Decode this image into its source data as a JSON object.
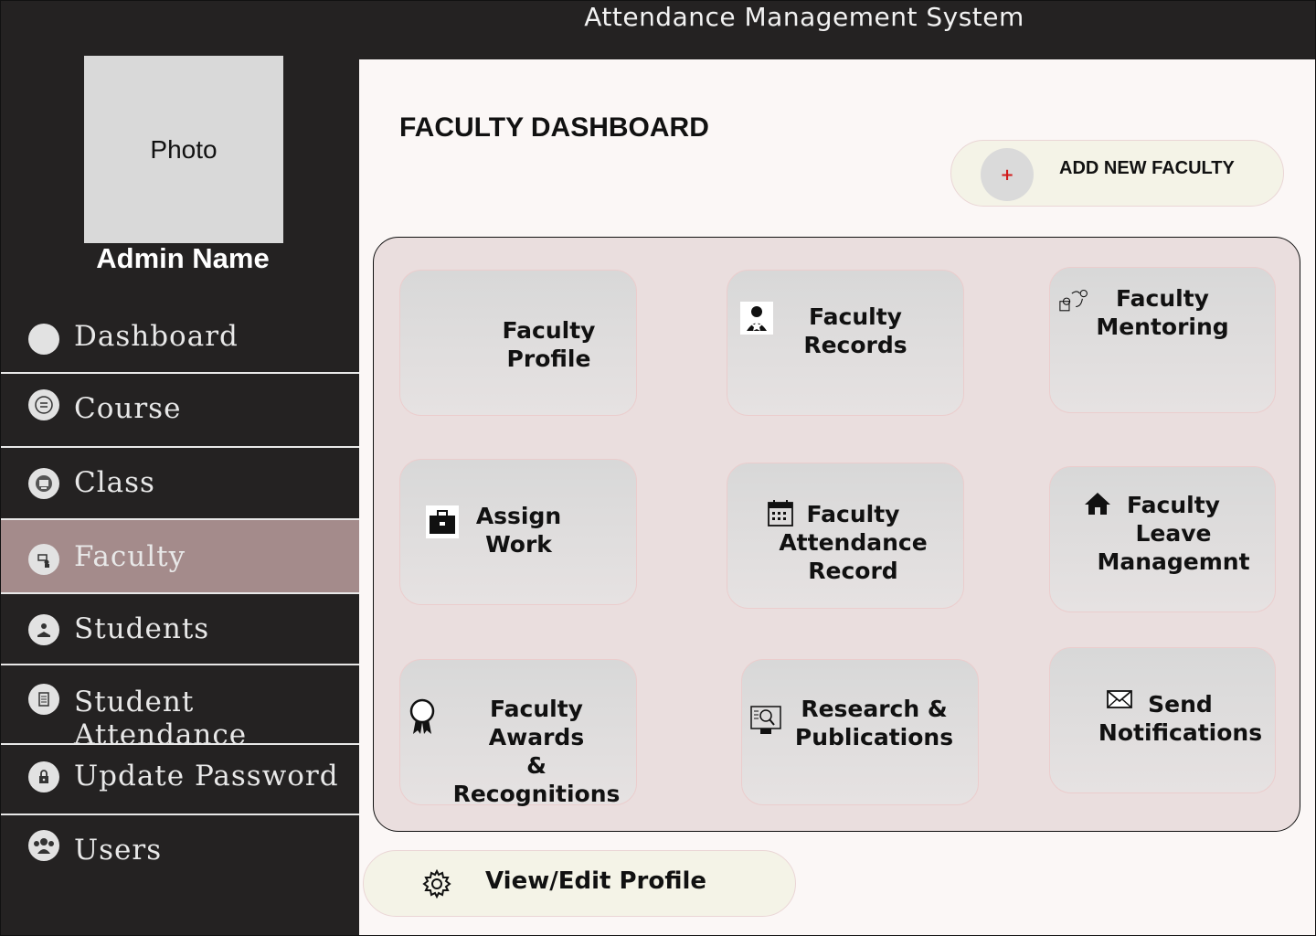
{
  "app": {
    "title": "Attendance Management System"
  },
  "sidebar": {
    "photo_label": "Photo",
    "admin_name": "Admin Name",
    "items": [
      {
        "label": "Dashboard",
        "icon": "circle-icon"
      },
      {
        "label": "Course",
        "icon": "list-icon"
      },
      {
        "label": "Class",
        "icon": "classroom-icon"
      },
      {
        "label": "Faculty",
        "icon": "teacher-icon",
        "active": true
      },
      {
        "label": "Students",
        "icon": "student-icon"
      },
      {
        "label": "Student Attendance",
        "icon": "clipboard-icon"
      },
      {
        "label": "Update Password",
        "icon": "lock-icon"
      },
      {
        "label": "Users",
        "icon": "users-icon"
      }
    ]
  },
  "main": {
    "page_title": "FACULTY DASHBOARD",
    "add_button": {
      "label": "ADD NEW FACULTY",
      "icon": "plus-icon",
      "plus": "+"
    },
    "cards": [
      {
        "label": "Faculty Profile",
        "icon": ""
      },
      {
        "label": "Faculty\nRecords",
        "icon": "faculty-icon"
      },
      {
        "label": "Faculty\nMentoring",
        "icon": "mentoring-icon"
      },
      {
        "label": "Assign\nWork",
        "icon": "briefcase-icon"
      },
      {
        "label": "Faculty\nAttendance\nRecord",
        "icon": "calendar-icon"
      },
      {
        "label": "Faculty\nLeave\nManagemnt",
        "icon": "home-icon"
      },
      {
        "label": "Faculty Awards\n& Recognitions",
        "icon": "award-icon"
      },
      {
        "label": "Research &\nPublications",
        "icon": "research-icon"
      },
      {
        "label": "Send\nNotifications",
        "icon": "mail-icon"
      }
    ],
    "profile_button": {
      "label": "View/Edit Profile",
      "icon": "gear-icon"
    }
  },
  "colors": {
    "sidebar_bg": "#242222",
    "active_item": "#a48b8b",
    "panel_bg": "#eadede",
    "button_bg": "#f4f3e7",
    "plus": "#d11a1a"
  }
}
